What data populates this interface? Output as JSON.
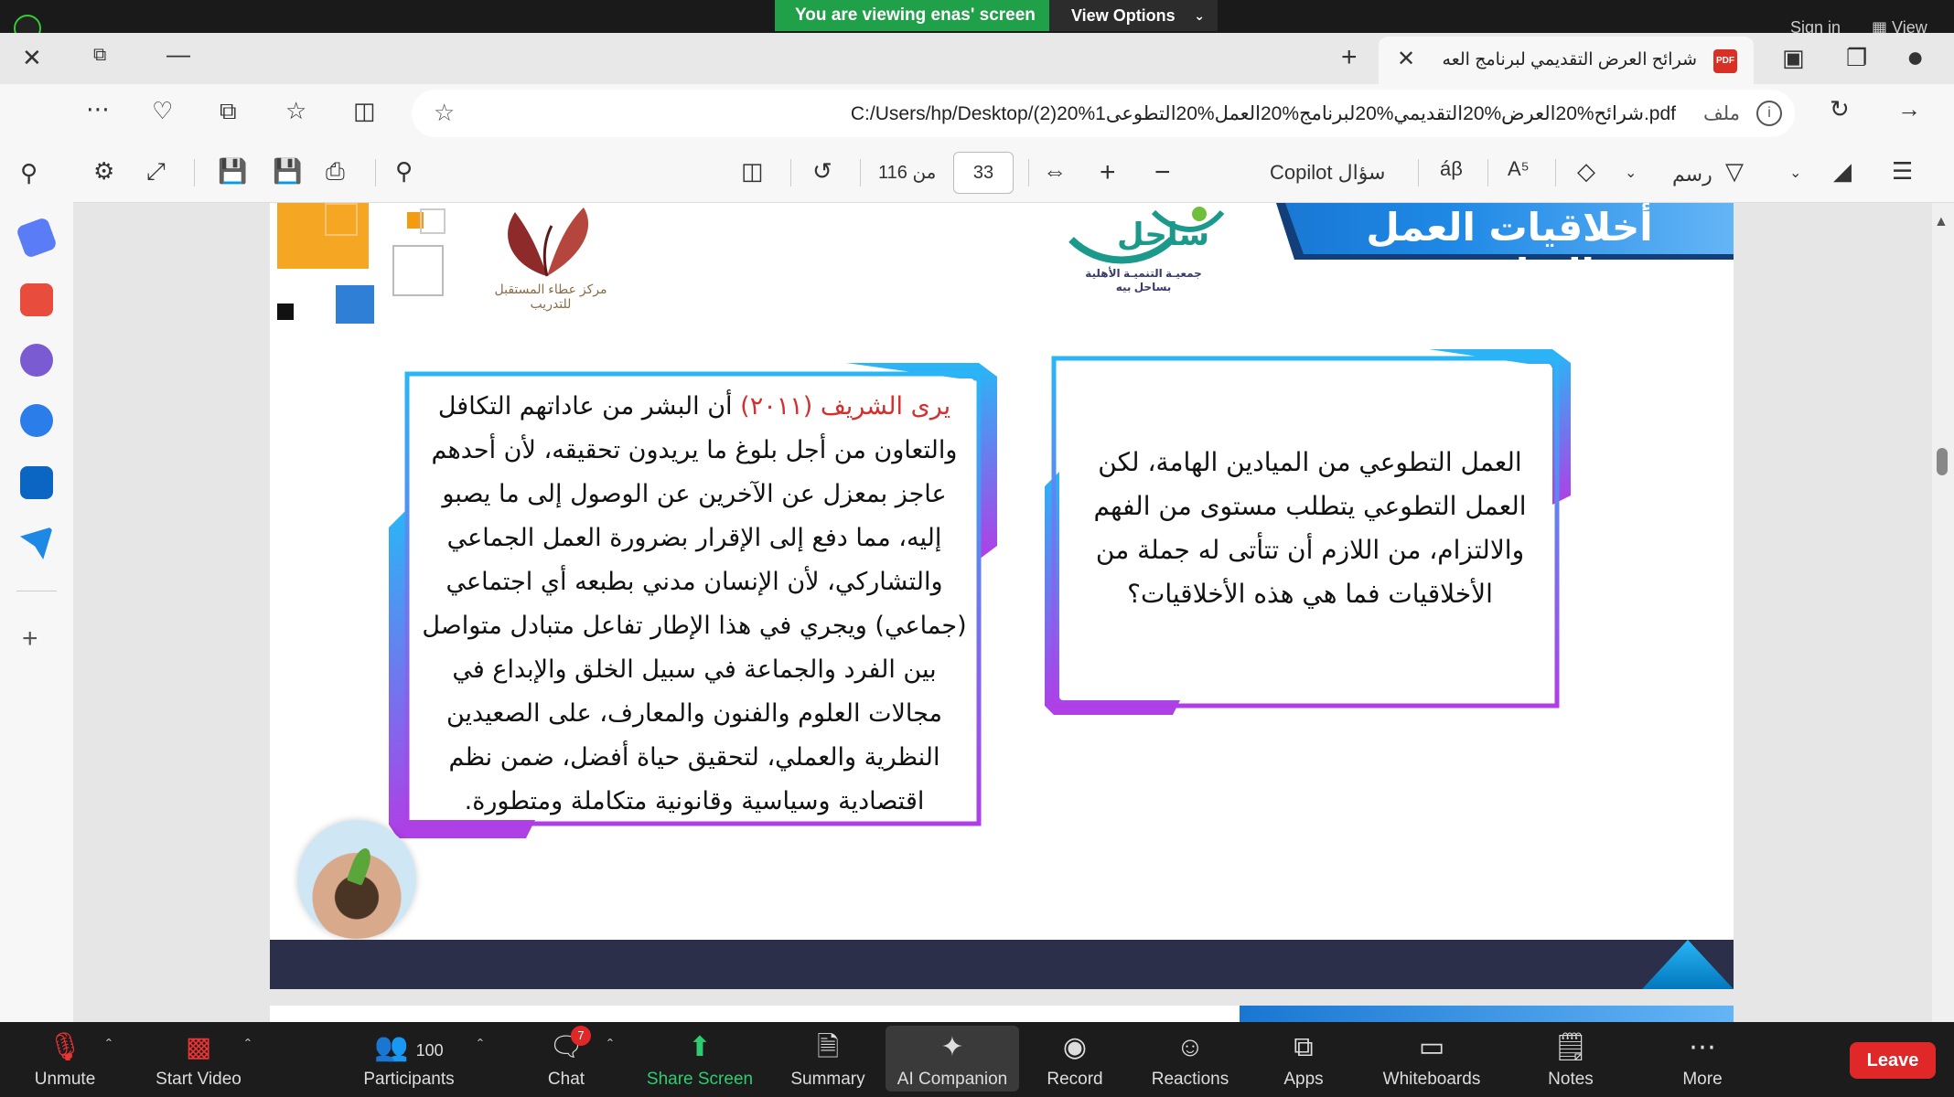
{
  "zoom_top": {
    "share_banner": "You are viewing enas' screen",
    "view_options": "View Options",
    "sign_in": "Sign in",
    "view": "View"
  },
  "browser": {
    "tab_title": "شرائح العرض التقديمي لبرنامج العه",
    "tab_icon_text": "PDF",
    "address_url": "C:/Users/hp/Desktop/(2)20%1شرائح%20العرض%20التقديمي%20لبرنامج%20العمل%20التطوعى.pdf",
    "address_file_label": "ملف"
  },
  "pdf_toolbar": {
    "page_current": "33",
    "page_total": "116 من",
    "copilot": "Copilot سؤال",
    "draw": "رسم"
  },
  "slide": {
    "title": "أخلاقيات العمل التطوعي",
    "logo_sahel_name": "ساحل",
    "logo_sahel_sub": "جمعيـة التنميـة الأهلية بساحل بيه",
    "logo_center_text": "مركز عطاء المستقبل للتدريب",
    "right_box_text": "العمل التطوعي من الميادين الهامة، لكن العمل التطوعي يتطلب مستوى من الفهم والالتزام، من اللازم أن تتأتى له جملة من الأخلاقيات فما هي هذه الأخلاقيات؟",
    "left_box_highlight": "يرى الشريف (٢٠١١)",
    "left_box_text": " أن البشر من عاداتهم التكافل والتعاون من أجل بلوغ ما يريدون تحقيقه، لأن أحدهم عاجز بمعزل عن الآخرين عن الوصول إلى ما يصبو إليه، مما دفع إلى الإقرار بضرورة العمل الجماعي والتشاركي، لأن الإنسان مدني بطبعه أي اجتماعي (جماعي) ويجري في هذا الإطار تفاعل متبادل متواصل بين الفرد والجماعة في سبيل الخلق والإبداع في مجالات العلوم والفنون والمعارف، على الصعيدين النظرية والعملي، لتحقيق حياة أفضل، ضمن نظم اقتصادية وسياسية وقانونية متكاملة ومتطورة."
  },
  "zoom_bottom": {
    "unmute": "Unmute",
    "start_video": "Start Video",
    "participants": "Participants",
    "participants_count": "100",
    "chat": "Chat",
    "chat_badge": "7",
    "share_screen": "Share Screen",
    "summary": "Summary",
    "ai_companion": "AI Companion",
    "record": "Record",
    "reactions": "Reactions",
    "apps": "Apps",
    "whiteboards": "Whiteboards",
    "notes": "Notes",
    "more": "More",
    "leave": "Leave"
  },
  "colors": {
    "share_green": "#21a04a",
    "leave_red": "#e02828",
    "title_blue": "#1e88e5",
    "box_gradient_start": "#29b6f6",
    "box_gradient_end": "#b03ee6",
    "highlight_red": "#d32f2f"
  }
}
